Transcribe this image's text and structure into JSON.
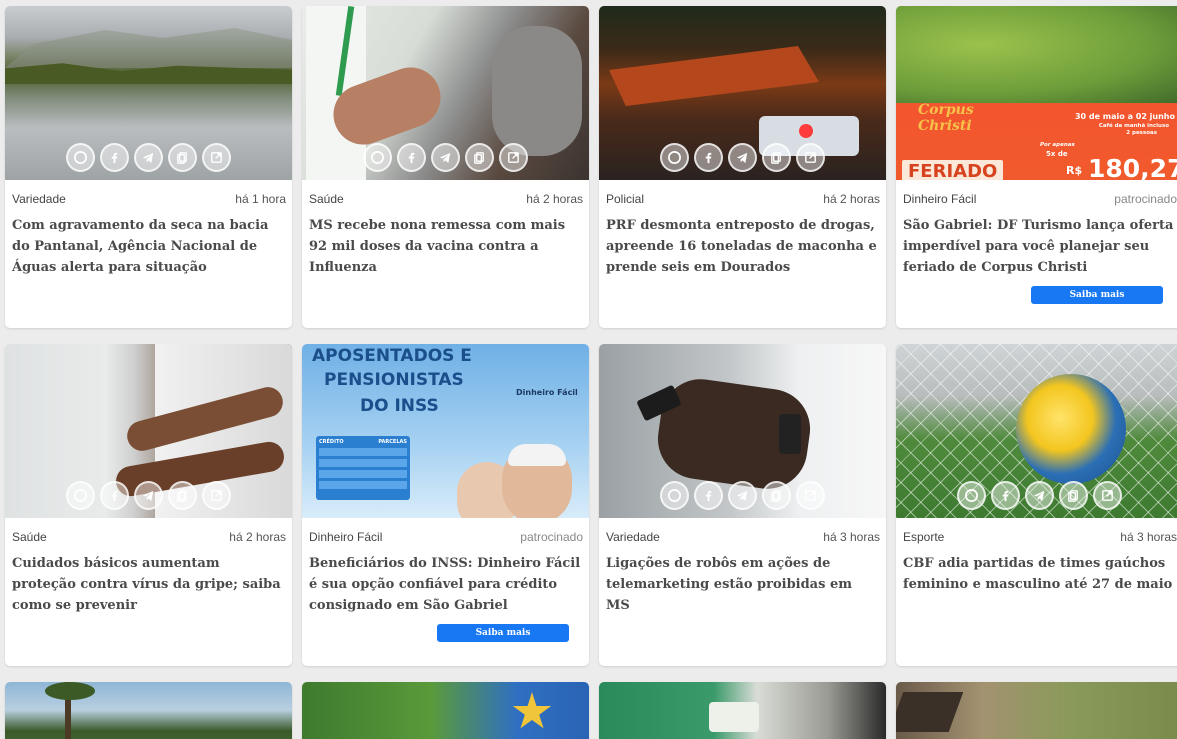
{
  "cards": [
    {
      "category": "Variedade",
      "time": "há 1 hora",
      "title": "Com agravamento da seca na bacia do Pantanal, Agência Nacional de Águas alerta para situação"
    },
    {
      "category": "Saúde",
      "time": "há 2 horas",
      "title": "MS recebe nona remessa com mais 92 mil doses da vacina contra a Influenza"
    },
    {
      "category": "Policial",
      "time": "há 2 horas",
      "title": "PRF desmonta entreposto de drogas, apreende 16 toneladas de maconha e prende seis em Dourados"
    },
    {
      "category": "Dinheiro Fácil",
      "time": "patrocinado",
      "title": "São Gabriel: DF Turismo lança oferta imperdível para você planejar seu feriado de Corpus Christi",
      "cta": "Saiba mais",
      "ad": {
        "script": "Corpus Christi",
        "dates": "30 de maio a 02 junho",
        "note1": "Café da manhã incluso",
        "note2": "2 pessoas",
        "note3": "Por apenas",
        "installments": "5x de",
        "currency": "R$",
        "price": "180,27",
        "banner": "FERIADO"
      }
    },
    {
      "category": "Saúde",
      "time": "há 2 horas",
      "title": "Cuidados básicos aumentam proteção contra vírus da gripe; saiba como se prevenir"
    },
    {
      "category": "Dinheiro Fácil",
      "time": "patrocinado",
      "title": "Beneficiários do INSS: Dinheiro Fácil é sua opção confiável para crédito consignado em São Gabriel",
      "cta": "Saiba mais",
      "ad": {
        "line1": "APOSENTADOS E",
        "line2": "PENSIONISTAS",
        "line3": "DO INSS",
        "brand": "Dinheiro Fácil",
        "col1": "CRÉDITO",
        "col2": "PARCELAS"
      }
    },
    {
      "category": "Variedade",
      "time": "há 3 horas",
      "title": "Ligações de robôs em ações de telemarketing estão proibidas em MS"
    },
    {
      "category": "Esporte",
      "time": "há 3 horas",
      "title": "CBF adia partidas de times gaúchos feminino e masculino até 27 de maio"
    }
  ],
  "share_icons": [
    "whatsapp-icon",
    "facebook-icon",
    "telegram-icon",
    "copy-icon",
    "external-link-icon"
  ],
  "colors": {
    "cta": "#1877f2",
    "card": "#ffffff",
    "background": "#ececec"
  }
}
